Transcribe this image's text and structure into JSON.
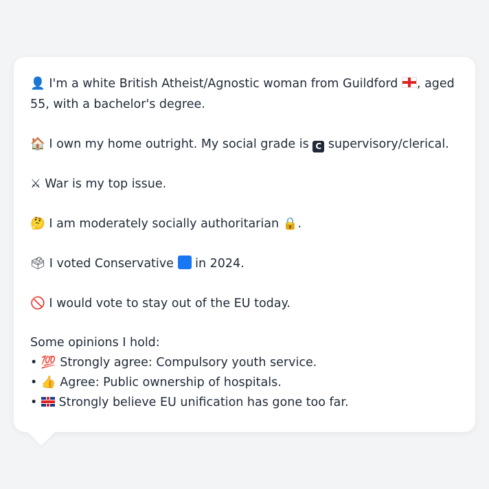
{
  "profile": {
    "intro": {
      "icon": "person-silhouette",
      "text_before_flag": "I'm a white British Atheist/Agnostic woman from Guildford",
      "flag": "england-flag",
      "text_after_flag": ", aged 55, with a bachelor's degree."
    },
    "home": {
      "icon": "house-icon",
      "text_before": "I own my home outright. My social grade is",
      "grade_badge": "C",
      "text_after": "supervisory/clerical."
    },
    "issue": {
      "icon": "crossed-swords-icon",
      "text": "War is my top issue."
    },
    "social": {
      "icon": "thinking-face-icon",
      "text": "I am moderately socially authoritarian",
      "trailing_icon": "lock-icon",
      "trailing_punct": "."
    },
    "vote": {
      "icon": "ballot-box-icon",
      "text_before": "I voted Conservative",
      "party_color": "#1877f2",
      "text_after": "in 2024."
    },
    "eu": {
      "icon": "no-entry-icon",
      "text": "I would vote to stay out of the EU today."
    },
    "opinions": {
      "heading": "Some opinions I hold:",
      "items": [
        {
          "icon": "hundred-points-icon",
          "text": "Strongly agree: Compulsory youth service."
        },
        {
          "icon": "thumbs-up-icon",
          "text": "Agree: Public ownership of hospitals."
        },
        {
          "icon": "uk-flag-icon",
          "text": "Strongly believe EU unification has gone too far."
        }
      ]
    }
  }
}
